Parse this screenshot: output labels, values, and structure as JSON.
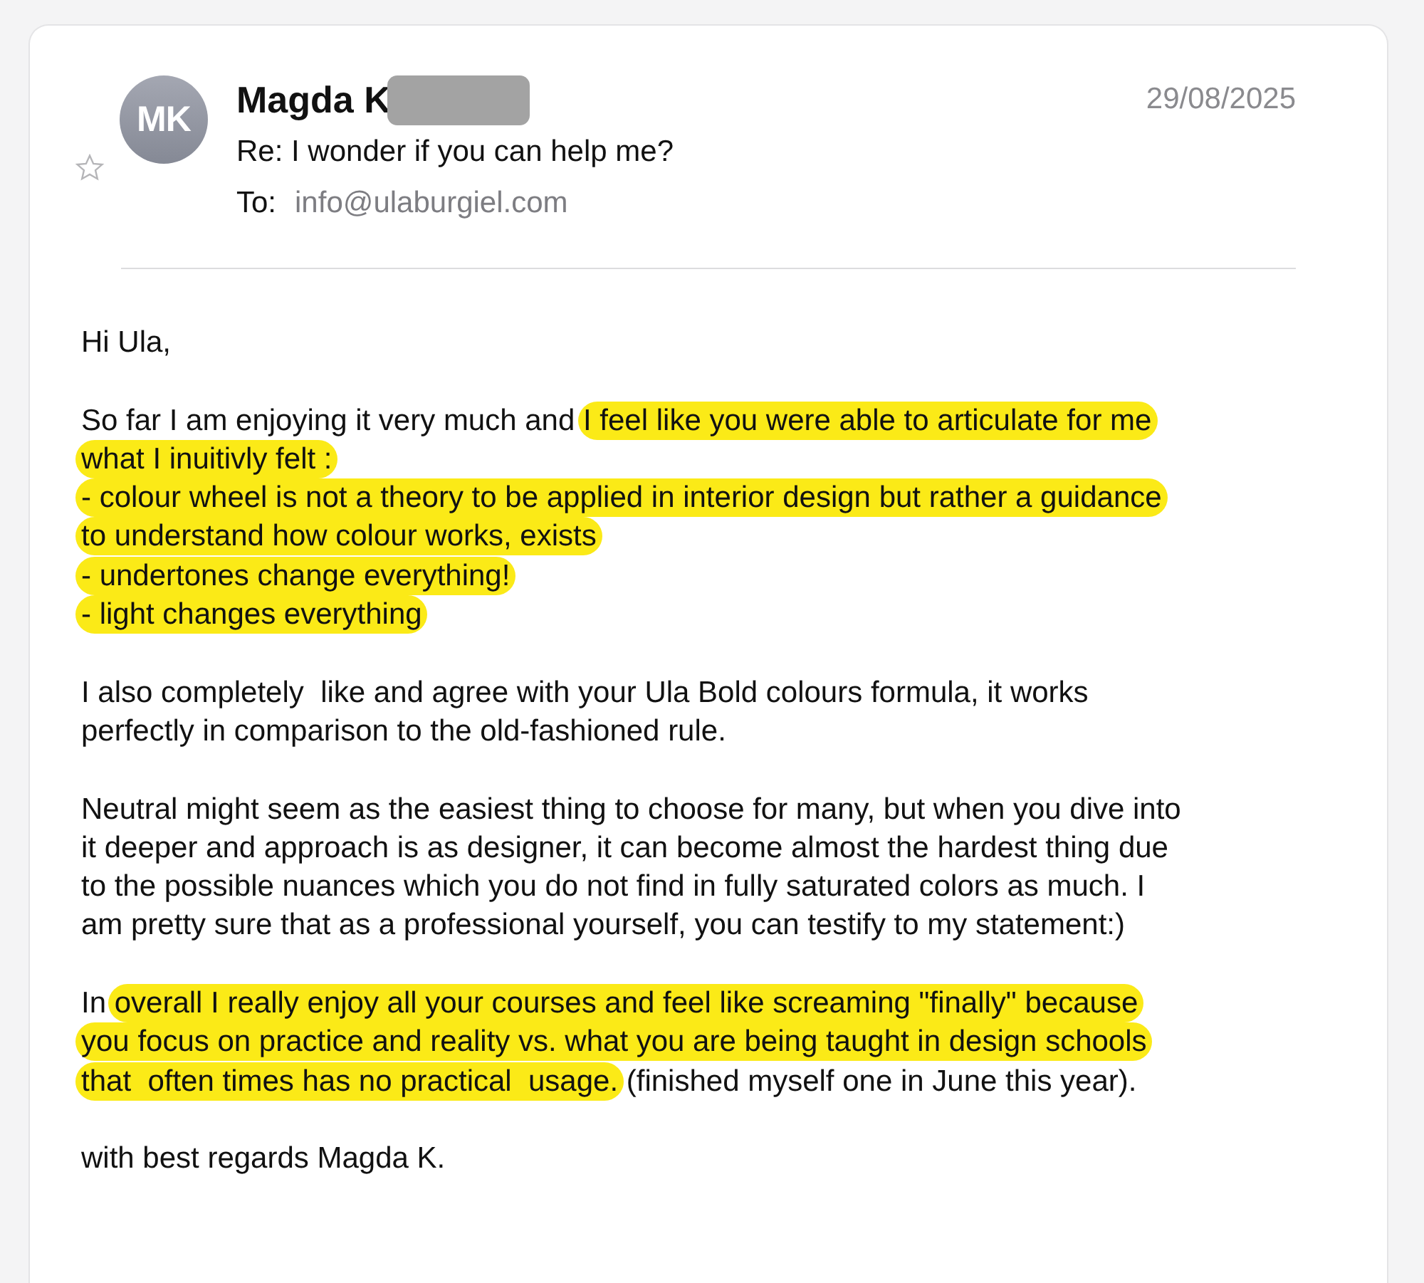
{
  "message": {
    "starred": false,
    "avatar_initials": "MK",
    "sender": "Magda K",
    "sender_redacted": true,
    "date": "29/08/2025",
    "subject": "Re: I wonder if you can help me?",
    "to_label": "To:",
    "to_address": "info@ulaburgiel.com"
  },
  "body": [
    [
      {
        "text": "Hi Ula,",
        "highlighted": false
      }
    ],
    [
      {
        "text": "So far I am enjoying it very much and ",
        "highlighted": false
      },
      {
        "text": "I feel like you were able to articulate for me\nwhat I inuitivly felt :\n- colour wheel is not a theory to be applied in interior design but rather a guidance\nto understand how colour works, exists\n- undertones change everything!\n- light changes everything",
        "highlighted": true
      }
    ],
    [
      {
        "text": "I also completely  like and agree with your Ula Bold colours formula, it works\nperfectly in comparison to the old-fashioned rule.",
        "highlighted": false
      }
    ],
    [
      {
        "text": "Neutral might seem as the easiest thing to choose for many, but when you dive into\nit deeper and approach is as designer, it can become almost the hardest thing due\nto the possible nuances which you do not find in fully saturated colors as much. I\nam pretty sure that as a professional yourself, you can testify to my statement:)",
        "highlighted": false
      }
    ],
    [
      {
        "text": "In ",
        "highlighted": false
      },
      {
        "text": "overall I really enjoy all your courses and feel like screaming \"finally\" because\nyou focus on practice and reality vs. what you are being taught in design schools\nthat  often times has no practical  usage.",
        "highlighted": true
      },
      {
        "text": " (finished myself one in June this year).",
        "highlighted": false
      }
    ],
    [
      {
        "text": "with best regards Magda K.",
        "highlighted": false
      }
    ]
  ]
}
